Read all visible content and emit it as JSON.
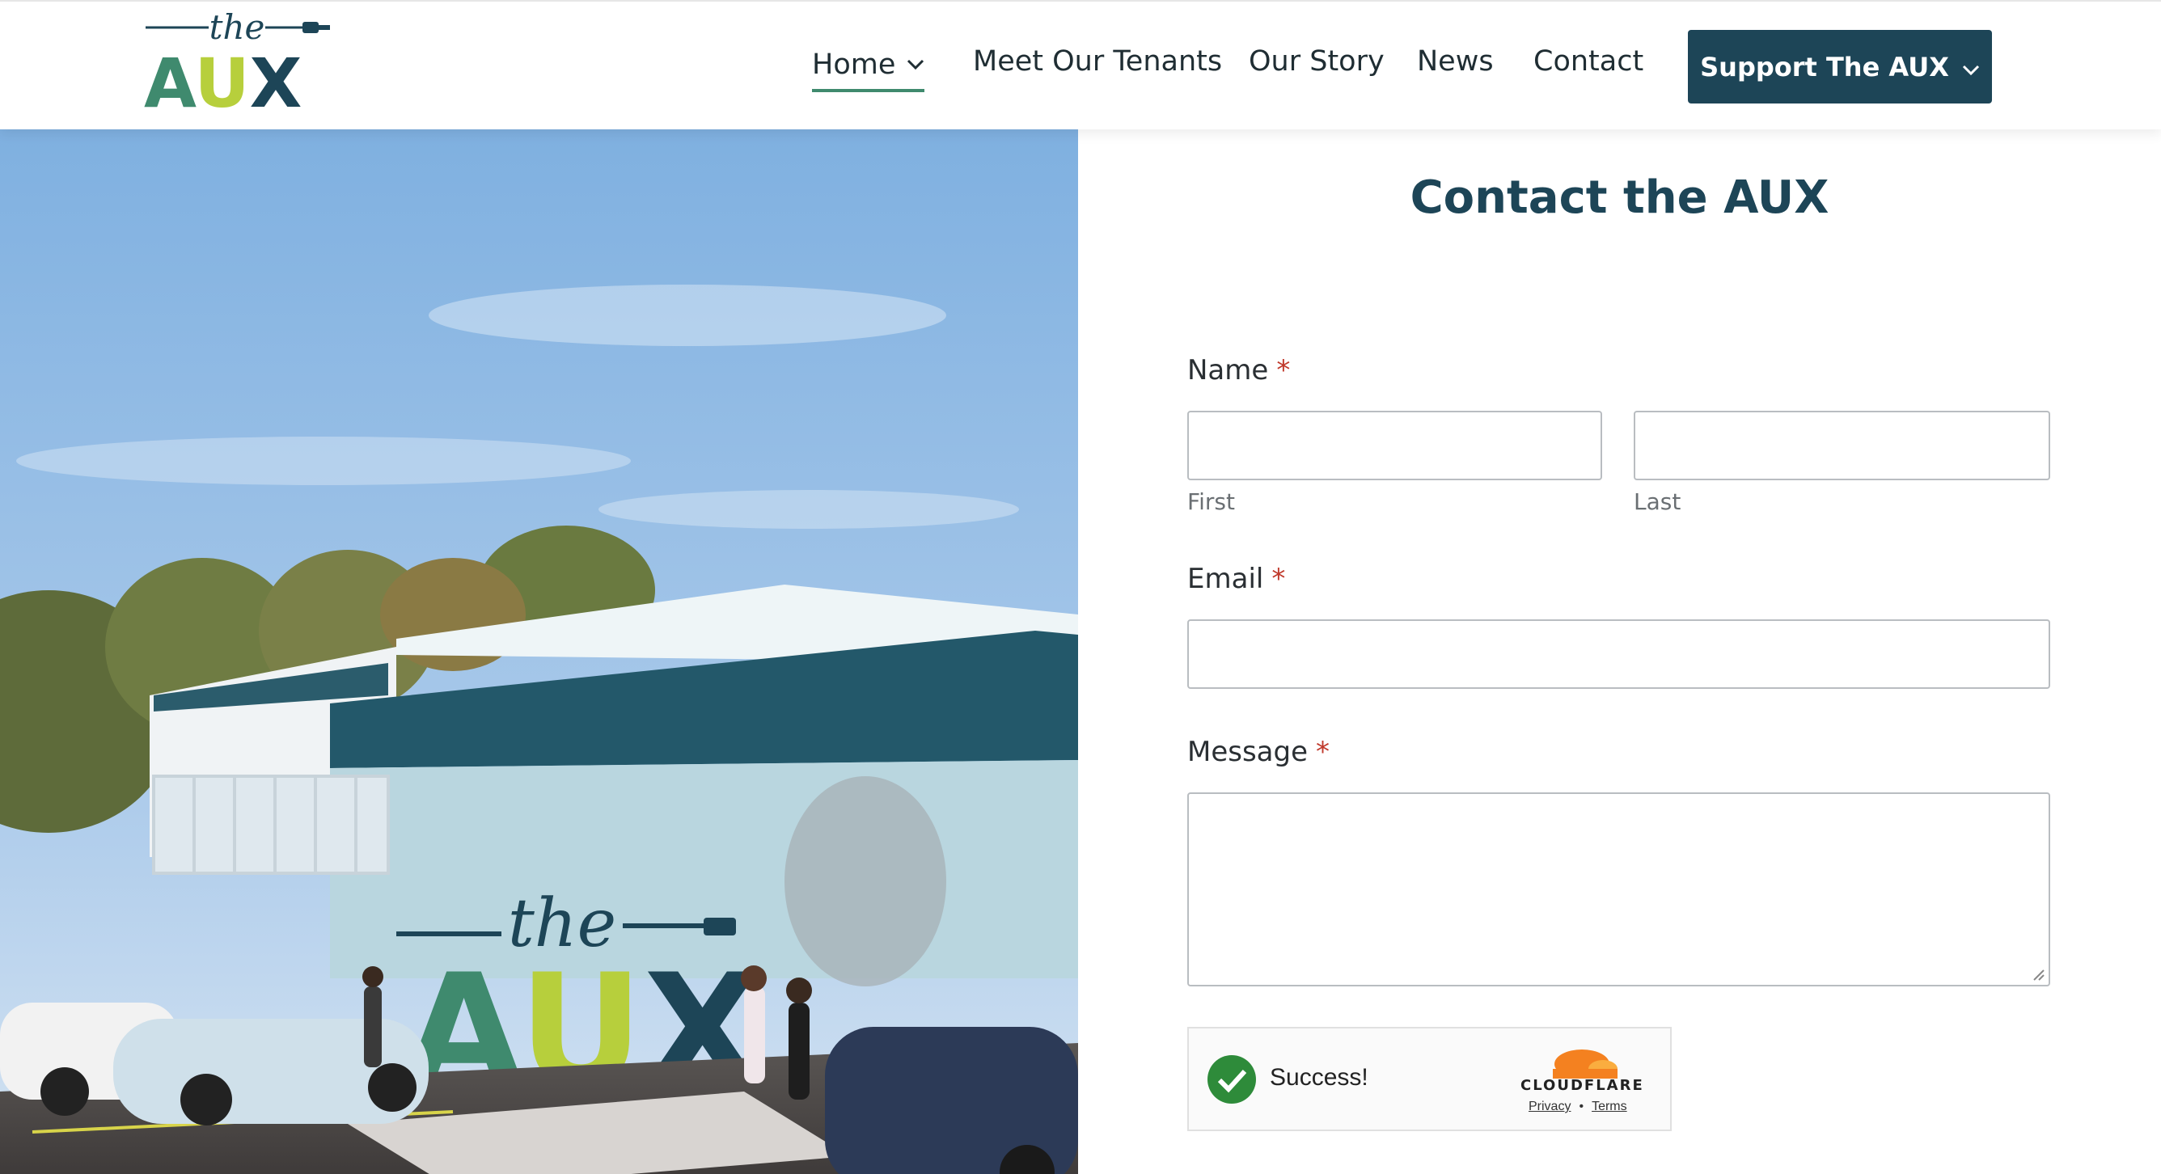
{
  "brand": {
    "logo_small_word": "the",
    "logo_big_word": "AUX",
    "colors": {
      "primary": "#1d4557",
      "green": "#3f8a6e",
      "lime": "#b7cf3c",
      "required": "#c0392b"
    }
  },
  "nav": {
    "items": [
      {
        "label": "Home",
        "active": true,
        "has_dropdown": true
      },
      {
        "label": "Meet Our Tenants"
      },
      {
        "label": "Our Story"
      },
      {
        "label": "News"
      },
      {
        "label": "Contact"
      }
    ],
    "cta_label": "Support The AUX"
  },
  "hero": {
    "mural_small_word": "the",
    "mural_big_word": "AUX"
  },
  "form": {
    "title": "Contact the AUX",
    "name_label": "Name",
    "required_mark": "*",
    "first_sublabel": "First",
    "last_sublabel": "Last",
    "first_value": "",
    "last_value": "",
    "email_label": "Email",
    "email_value": "",
    "message_label": "Message",
    "message_value": ""
  },
  "captcha": {
    "status": "Success!",
    "provider": "CLOUDFLARE",
    "privacy_link": "Privacy",
    "separator": "•",
    "terms_link": "Terms"
  }
}
